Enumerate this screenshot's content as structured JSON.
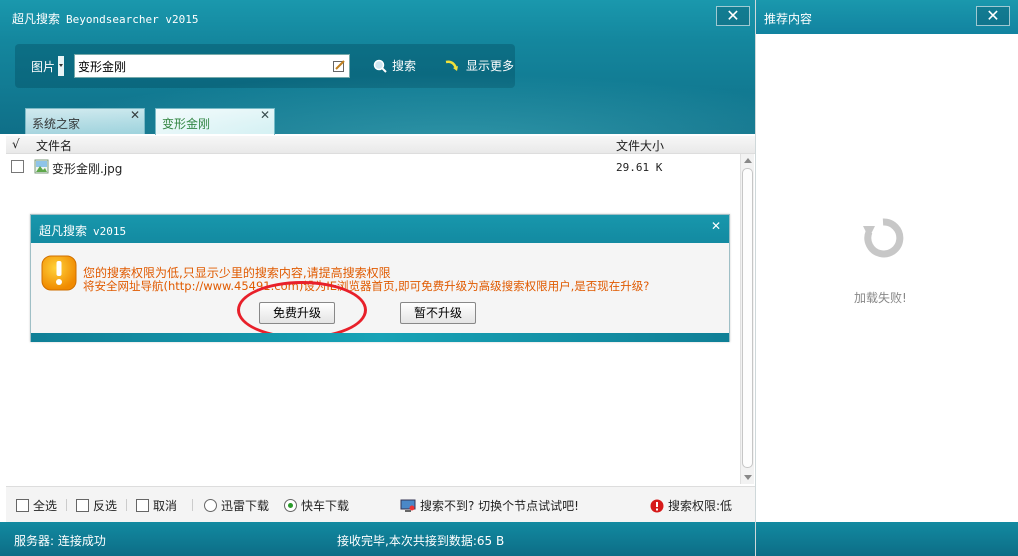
{
  "app": {
    "title": "超凡搜索",
    "subtitle": "Beyondsearcher v2015",
    "close_symbol": "✕"
  },
  "search": {
    "type_label": "图片",
    "query": "变形金刚",
    "search_label": "搜索",
    "more_label": "显示更多"
  },
  "tabs": [
    {
      "label": "系统之家",
      "close": "✕"
    },
    {
      "label": "变形金刚",
      "close": "✕"
    }
  ],
  "list": {
    "col_check": "√",
    "col_name": "文件名",
    "col_size": "文件大小",
    "rows": [
      {
        "name": "变形金刚.jpg",
        "size": "29.61 K"
      }
    ]
  },
  "options": {
    "select_all": "全选",
    "invert": "反选",
    "cancel": "取消",
    "xunlei": "迅雷下载",
    "kuaiche": "快车下载",
    "not_found": "搜索不到? 切换个节点试试吧!",
    "permission": "搜索权限:低"
  },
  "status": {
    "server": "服务器: 连接成功",
    "message": "接收完毕,本次共接到数据:65 B"
  },
  "side": {
    "title": "推荐内容",
    "load_failed": "加载失败!"
  },
  "dialog": {
    "title": "超凡搜索",
    "version": "v2015",
    "close": "✕",
    "line1": "您的搜索权限为低,只显示少里的搜索内容,请提高搜索权限",
    "line2": "将安全网址导航(http://www.45491.com)设为IE浏览器首页,即可免费升级为高级搜索权限用户,是否现在升级?",
    "upgrade_label": "免费升级",
    "later_label": "暂不升级"
  },
  "colors": {
    "accent": "#1493aa",
    "warning_text": "#e05a00",
    "highlight_ring": "#e8202a"
  }
}
